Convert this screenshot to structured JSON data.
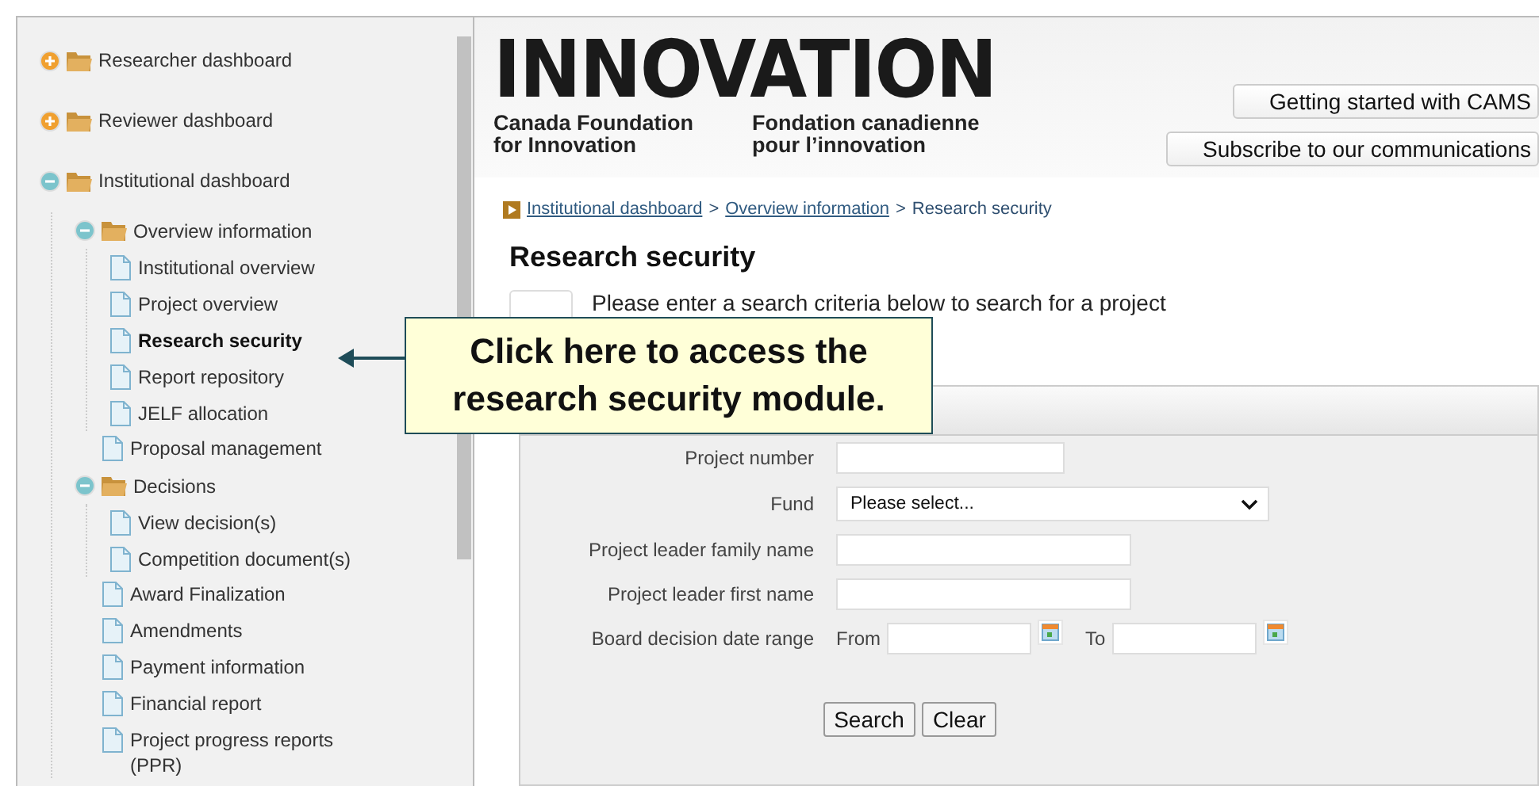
{
  "sidebar": {
    "tree": [
      {
        "label": "Researcher dashboard",
        "kind": "folder",
        "expanded": false,
        "selected": false
      },
      {
        "label": "Reviewer dashboard",
        "kind": "folder",
        "expanded": false,
        "selected": false
      },
      {
        "label": "Institutional dashboard",
        "kind": "folder",
        "expanded": true,
        "selected": false,
        "children": [
          {
            "label": "Overview information",
            "kind": "folder",
            "expanded": true,
            "selected": false,
            "children": [
              {
                "label": "Institutional overview",
                "kind": "page",
                "selected": false
              },
              {
                "label": "Project overview",
                "kind": "page",
                "selected": false
              },
              {
                "label": "Research security",
                "kind": "page",
                "selected": true
              },
              {
                "label": "Report repository",
                "kind": "page",
                "selected": false
              },
              {
                "label": "JELF allocation",
                "kind": "page",
                "selected": false
              }
            ]
          },
          {
            "label": "Proposal management",
            "kind": "page",
            "selected": false
          },
          {
            "label": "Decisions",
            "kind": "folder",
            "expanded": true,
            "selected": false,
            "children": [
              {
                "label": "View decision(s)",
                "kind": "page",
                "selected": false
              },
              {
                "label": "Competition document(s)",
                "kind": "page",
                "selected": false
              }
            ]
          },
          {
            "label": "Award Finalization",
            "kind": "page",
            "selected": false
          },
          {
            "label": "Amendments",
            "kind": "page",
            "selected": false
          },
          {
            "label": "Payment information",
            "kind": "page",
            "selected": false
          },
          {
            "label": "Financial report",
            "kind": "page",
            "selected": false
          },
          {
            "label": "Project progress reports (PPR)",
            "kind": "page",
            "selected": false
          }
        ]
      }
    ]
  },
  "header": {
    "logo": {
      "wordmark": "INNOVATION",
      "name_en": "Canada Foundation for Innovation",
      "name_fr": "Fondation canadienne pour l’innovation"
    },
    "buttons": [
      "Getting started with CAMS",
      "Subscribe to our communications"
    ]
  },
  "breadcrumb": [
    {
      "label": "Institutional dashboard",
      "kind": "link",
      "separator": ">"
    },
    {
      "label": "Overview information",
      "kind": "link",
      "separator": ">"
    },
    {
      "label": "Research security",
      "kind": "current"
    }
  ],
  "page_title": "Research security",
  "info_message": "Please enter a search criteria below to search for a project",
  "search_form": {
    "fields": [
      {
        "label": "Project number",
        "kind": "text"
      },
      {
        "label": "Fund",
        "kind": "select",
        "value": "Please select..."
      },
      {
        "label": "Project leader family name",
        "kind": "text"
      },
      {
        "label": "Project leader first name",
        "kind": "text"
      },
      {
        "label": "Board decision date range",
        "kind": "daterange",
        "from_label": "From",
        "to_label": "To"
      }
    ],
    "buttons": [
      "Search",
      "Clear"
    ]
  },
  "callout": {
    "text": "Click here to access the research security module."
  }
}
